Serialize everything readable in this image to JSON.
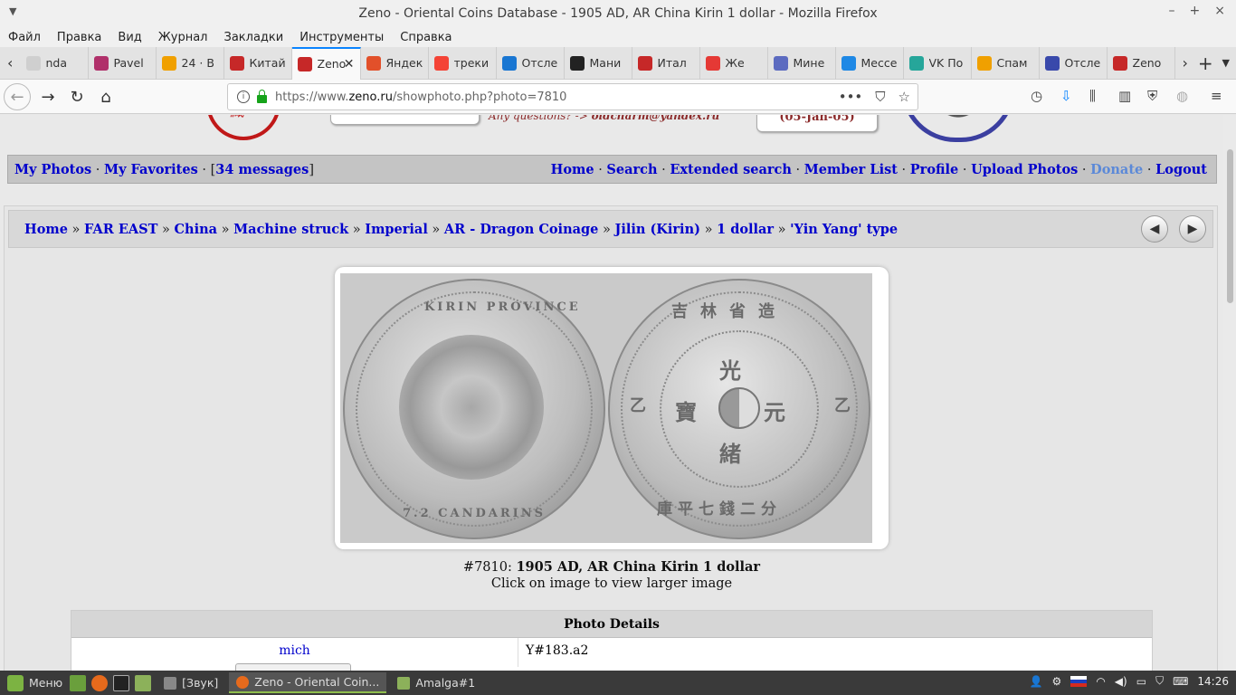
{
  "window": {
    "title": "Zeno - Oriental Coins Database - 1905 AD, AR China Kirin 1 dollar - Mozilla Firefox",
    "controls": [
      "–",
      "+",
      "×"
    ]
  },
  "menubar": [
    "Файл",
    "Правка",
    "Вид",
    "Журнал",
    "Закладки",
    "Инструменты",
    "Справка"
  ],
  "tabs": [
    {
      "label": "nda",
      "icon": "generic-icon",
      "color": "#cfcfcf"
    },
    {
      "label": "Pavel",
      "icon": "book-icon",
      "color": "#b0306a"
    },
    {
      "label": "24 · В",
      "icon": "mail-icon",
      "color": "#f0a000"
    },
    {
      "label": "Китай",
      "icon": "hammer-icon",
      "color": "#c62828"
    },
    {
      "label": "Zeno",
      "icon": "zeno-icon",
      "color": "#c62828",
      "active": true
    },
    {
      "label": "Яндек",
      "icon": "yandex-browser-icon",
      "color": "#e2502a"
    },
    {
      "label": "треки",
      "icon": "yandex-icon",
      "color": "#f44336"
    },
    {
      "label": "Отсле",
      "icon": "calendar-icon",
      "color": "#1976d2"
    },
    {
      "label": "Мани",
      "icon": "wikipedia-icon",
      "color": "#222222"
    },
    {
      "label": "Итал",
      "icon": "m-icon",
      "color": "#c62828"
    },
    {
      "label": "Же",
      "icon": "youtube-icon",
      "color": "#e53935"
    },
    {
      "label": "Мине",
      "icon": "crossed-tools-icon",
      "color": "#5c6bc0"
    },
    {
      "label": "Мессе",
      "icon": "messenger-icon",
      "color": "#1e88e5"
    },
    {
      "label": "VK По",
      "icon": "vk-icon",
      "color": "#26a69a"
    },
    {
      "label": "Спам",
      "icon": "mail-icon",
      "color": "#f0a000"
    },
    {
      "label": "Отсле",
      "icon": "eagle-icon",
      "color": "#3949ab"
    },
    {
      "label": "Zeno",
      "icon": "zeno-icon",
      "color": "#c62828"
    }
  ],
  "navbar": {
    "url_prefix": "https://www.",
    "url_domain": "zeno.ru",
    "url_path": "/showphoto.php?photo=7810"
  },
  "header": {
    "question_text": "Any questions? -> ",
    "question_email": "oldcharm@yandex.ru",
    "date": "(05-Jan-05)"
  },
  "userbar": {
    "left": [
      {
        "label": "My Photos"
      },
      {
        "label": "My Favorites"
      }
    ],
    "messages_count": "34 messages",
    "right": [
      "Home",
      "Search",
      "Extended search",
      "Member List",
      "Profile",
      "Upload Photos",
      "Donate",
      "Logout"
    ]
  },
  "breadcrumb": [
    "Home",
    "FAR EAST",
    "China",
    "Machine struck",
    "Imperial",
    "AR - Dragon Coinage",
    "Jilin (Kirin)",
    "1 dollar",
    "'Yin Yang' type"
  ],
  "photo": {
    "number": "#7810:",
    "title": "1905 AD, AR China Kirin 1 dollar",
    "hint": "Click on image to view larger image",
    "obverse_legend_top": "KIRIN PROVINCE",
    "obverse_legend_bottom": "7.2 CANDARINS",
    "reverse_chars_top": "吉林省造",
    "reverse_center": [
      "光",
      "緒",
      "元",
      "寶"
    ],
    "reverse_chars_bottom": "庫平七錢二分",
    "reverse_side_left": "乙",
    "reverse_side_right": "乙"
  },
  "details": {
    "heading": "Photo Details",
    "user": "mich",
    "catalog": "Y#183.a2"
  },
  "taskbar": {
    "menu_label": "Меню",
    "windows": [
      {
        "label": "[Звук]",
        "active": false
      },
      {
        "label": "Zeno - Oriental Coin...",
        "active": true
      },
      {
        "label": "Amalga#1",
        "active": false
      }
    ],
    "clock": "14:26"
  }
}
